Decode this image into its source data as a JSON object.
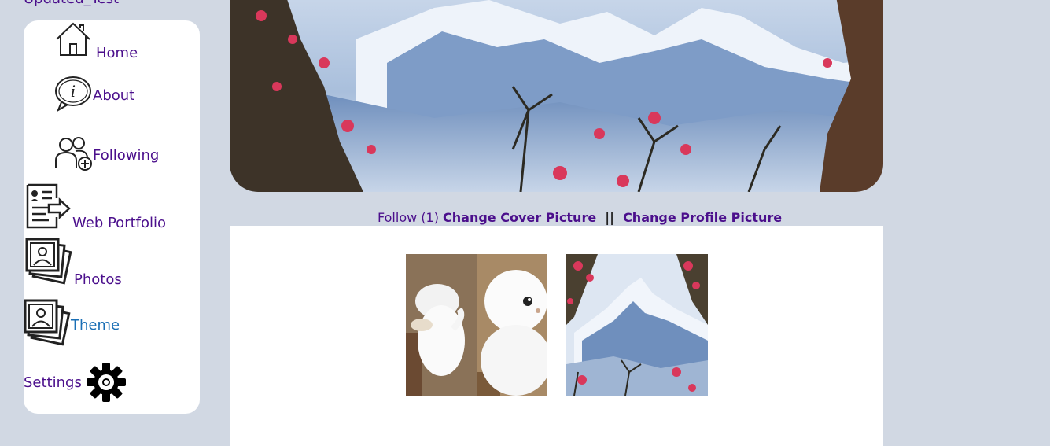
{
  "user": {
    "name": "Updated_Test"
  },
  "nav": {
    "home": "Home",
    "about": "About",
    "following": "Following",
    "web_portfolio": "Web Portfolio",
    "photos": "Photos",
    "theme": "Theme",
    "settings": "Settings"
  },
  "icons": {
    "home": "house-icon",
    "about": "info-bubble-icon",
    "following": "people-add-icon",
    "web_portfolio": "resume-document-icon",
    "photos": "photo-stack-icon",
    "theme": "photo-stack-icon",
    "settings": "gear-icon"
  },
  "actions": {
    "follow": "Follow (1)",
    "change_cover": "Change Cover Picture",
    "separator": "||",
    "change_profile": "Change Profile Picture"
  },
  "colors": {
    "background": "#d1d8e3",
    "link": "#4b0f8c",
    "active_link": "#1a6fb5"
  }
}
